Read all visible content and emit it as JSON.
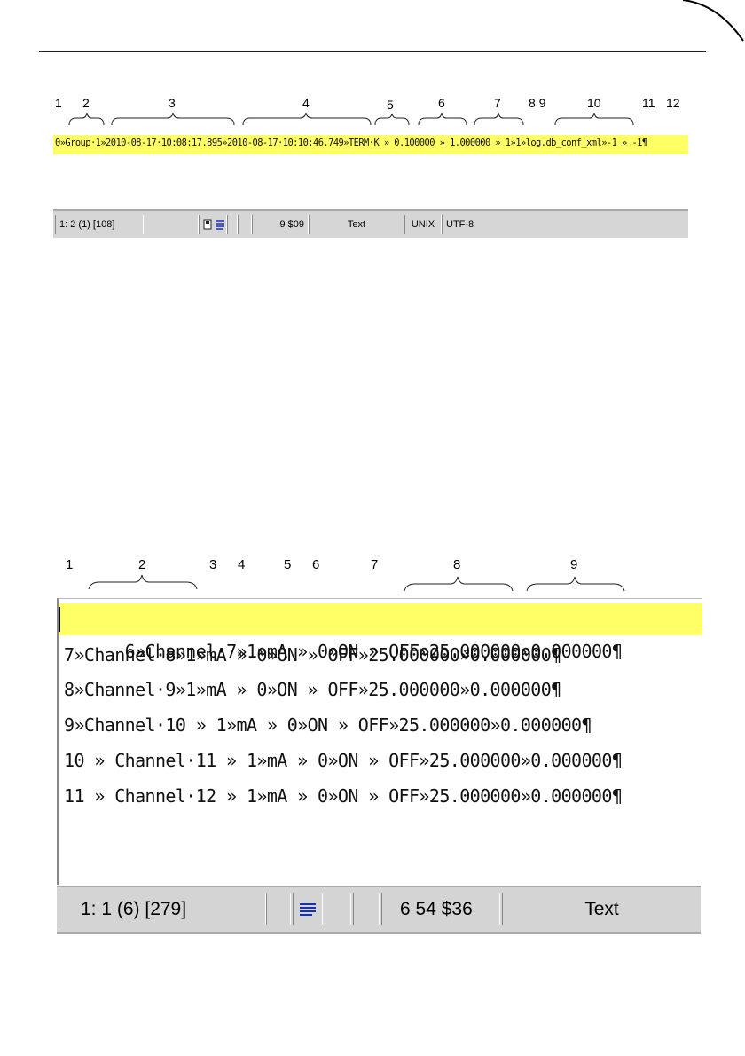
{
  "figure1": {
    "callouts": [
      "1",
      "2",
      "3",
      "4",
      "5",
      "6",
      "7",
      "8 9",
      "10",
      "11",
      "12"
    ],
    "line_text": "0»Group·1»2010-08-17·10:08:17.895»2010-08-17·10:10:46.749»TERM·K » 0.100000 » 1.000000 » 1»1»log.db_conf_xml»-1 » -1¶",
    "status": {
      "position": "1: 2  (1)  [108]",
      "column": "9  $09",
      "mode": "Text",
      "line_ending": "UNIX",
      "encoding": "UTF-8"
    }
  },
  "figure2": {
    "callouts": [
      "1",
      "2",
      "3",
      "4",
      "5",
      "6",
      "7",
      "8",
      "9"
    ],
    "rows": [
      "6»Channel·7»1»mA » 0»ON » OFF»25.000000»0.000000¶",
      "7»Channel·8»1»mA » 0»ON » OFF»25.000000»0.000000¶",
      "8»Channel·9»1»mA » 0»ON » OFF»25.000000»0.000000¶",
      "9»Channel·10 » 1»mA » 0»ON » OFF»25.000000»0.000000¶",
      "10 » Channel·11 » 1»mA » 0»ON » OFF»25.000000»0.000000¶",
      "11 » Channel·12 » 1»mA » 0»ON » OFF»25.000000»0.000000¶"
    ],
    "status": {
      "position": "1: 1  (6)  [279]",
      "column": "6  54 $36",
      "mode": "Text"
    }
  },
  "colors": {
    "highlight": "#ffff66",
    "statusbar": "#d4d4d4",
    "icon_blue": "#1a2fb0"
  }
}
